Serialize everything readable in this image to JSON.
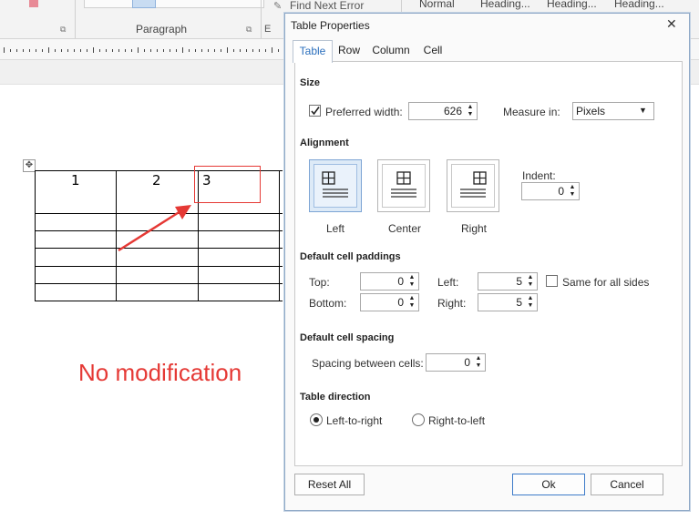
{
  "ribbon": {
    "paragraph_group": "Paragraph",
    "find_next_error": "Find Next Error",
    "styles": [
      "Normal",
      "Heading...",
      "Heading...",
      "Heading..."
    ]
  },
  "document": {
    "table_headers": [
      "1",
      "2",
      "3"
    ],
    "annotation": "No modification"
  },
  "dialog": {
    "title": "Table Properties",
    "close_glyph": "✕",
    "tabs": [
      "Table",
      "Row",
      "Column",
      "Cell"
    ],
    "active_tab": "Table",
    "size": {
      "heading": "Size",
      "preferred_width_label": "Preferred width:",
      "preferred_width_checked": true,
      "preferred_width_value": "626",
      "measure_in_label": "Measure in:",
      "measure_in_value": "Pixels"
    },
    "alignment": {
      "heading": "Alignment",
      "options": [
        "Left",
        "Center",
        "Right"
      ],
      "selected": "Left",
      "indent_label": "Indent:",
      "indent_value": "0"
    },
    "paddings": {
      "heading": "Default cell paddings",
      "top_label": "Top:",
      "top_value": "0",
      "bottom_label": "Bottom:",
      "bottom_value": "0",
      "left_label": "Left:",
      "left_value": "5",
      "right_label": "Right:",
      "right_value": "5",
      "same_for_all_label": "Same for all sides",
      "same_for_all_checked": false
    },
    "spacing": {
      "heading": "Default cell spacing",
      "between_label": "Spacing between cells:",
      "between_value": "0"
    },
    "direction": {
      "heading": "Table direction",
      "ltr_label": "Left-to-right",
      "rtl_label": "Right-to-left",
      "selected": "ltr"
    },
    "buttons": {
      "reset": "Reset All",
      "ok": "Ok",
      "cancel": "Cancel"
    }
  },
  "colors": {
    "annotation": "#e53935",
    "accent": "#2b6fbd"
  }
}
